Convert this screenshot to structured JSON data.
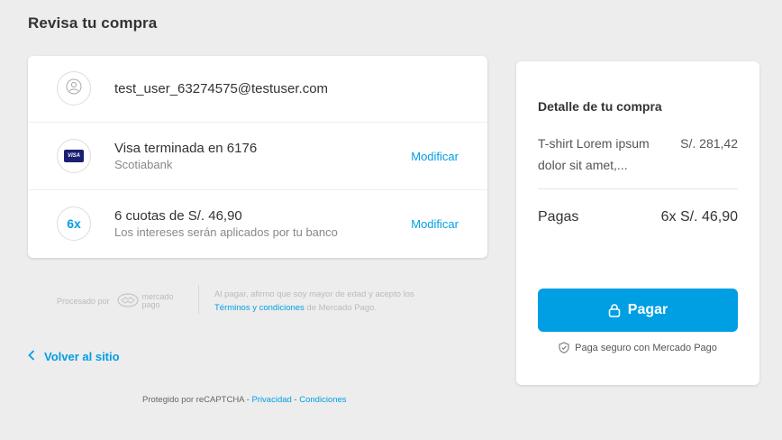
{
  "page": {
    "title": "Revisa tu compra"
  },
  "account": {
    "email": "test_user_63274575@testuser.com",
    "icon": "user-icon"
  },
  "card": {
    "brand_badge": "VISA",
    "label": "Visa terminada en 6176",
    "bank": "Scotiabank",
    "modify_label": "Modificar"
  },
  "installments": {
    "badge": "6x",
    "label": "6 cuotas de S/. 46,90",
    "note": "Los intereses serán aplicados por tu banco",
    "modify_label": "Modificar"
  },
  "processed": {
    "prefix": "Procesado por",
    "logo_line1": "mercado",
    "logo_line2": "pago"
  },
  "legal": {
    "text_before": "Al pagar, afirmo que soy mayor de edad y acepto los ",
    "terms_link": "Términos y condiciones",
    "text_after": " de Mercado Pago."
  },
  "back": {
    "label": "Volver al sitio"
  },
  "recaptcha": {
    "prefix": "Protegido por reCAPTCHA - ",
    "privacy": "Privacidad",
    "dash": " - ",
    "conditions": "Condiciones"
  },
  "summary": {
    "title": "Detalle de tu compra",
    "product_name": "T-shirt Lorem ipsum dolor sit amet,...",
    "product_price": "S/. 281,42",
    "pay_label": "Pagas",
    "pay_value": "6x S/. 46,90",
    "button_label": "Pagar",
    "secure_label": "Paga seguro con Mercado Pago"
  },
  "colors": {
    "accent": "#009ee3",
    "background": "#ededed",
    "visa": "#1a1f71"
  }
}
